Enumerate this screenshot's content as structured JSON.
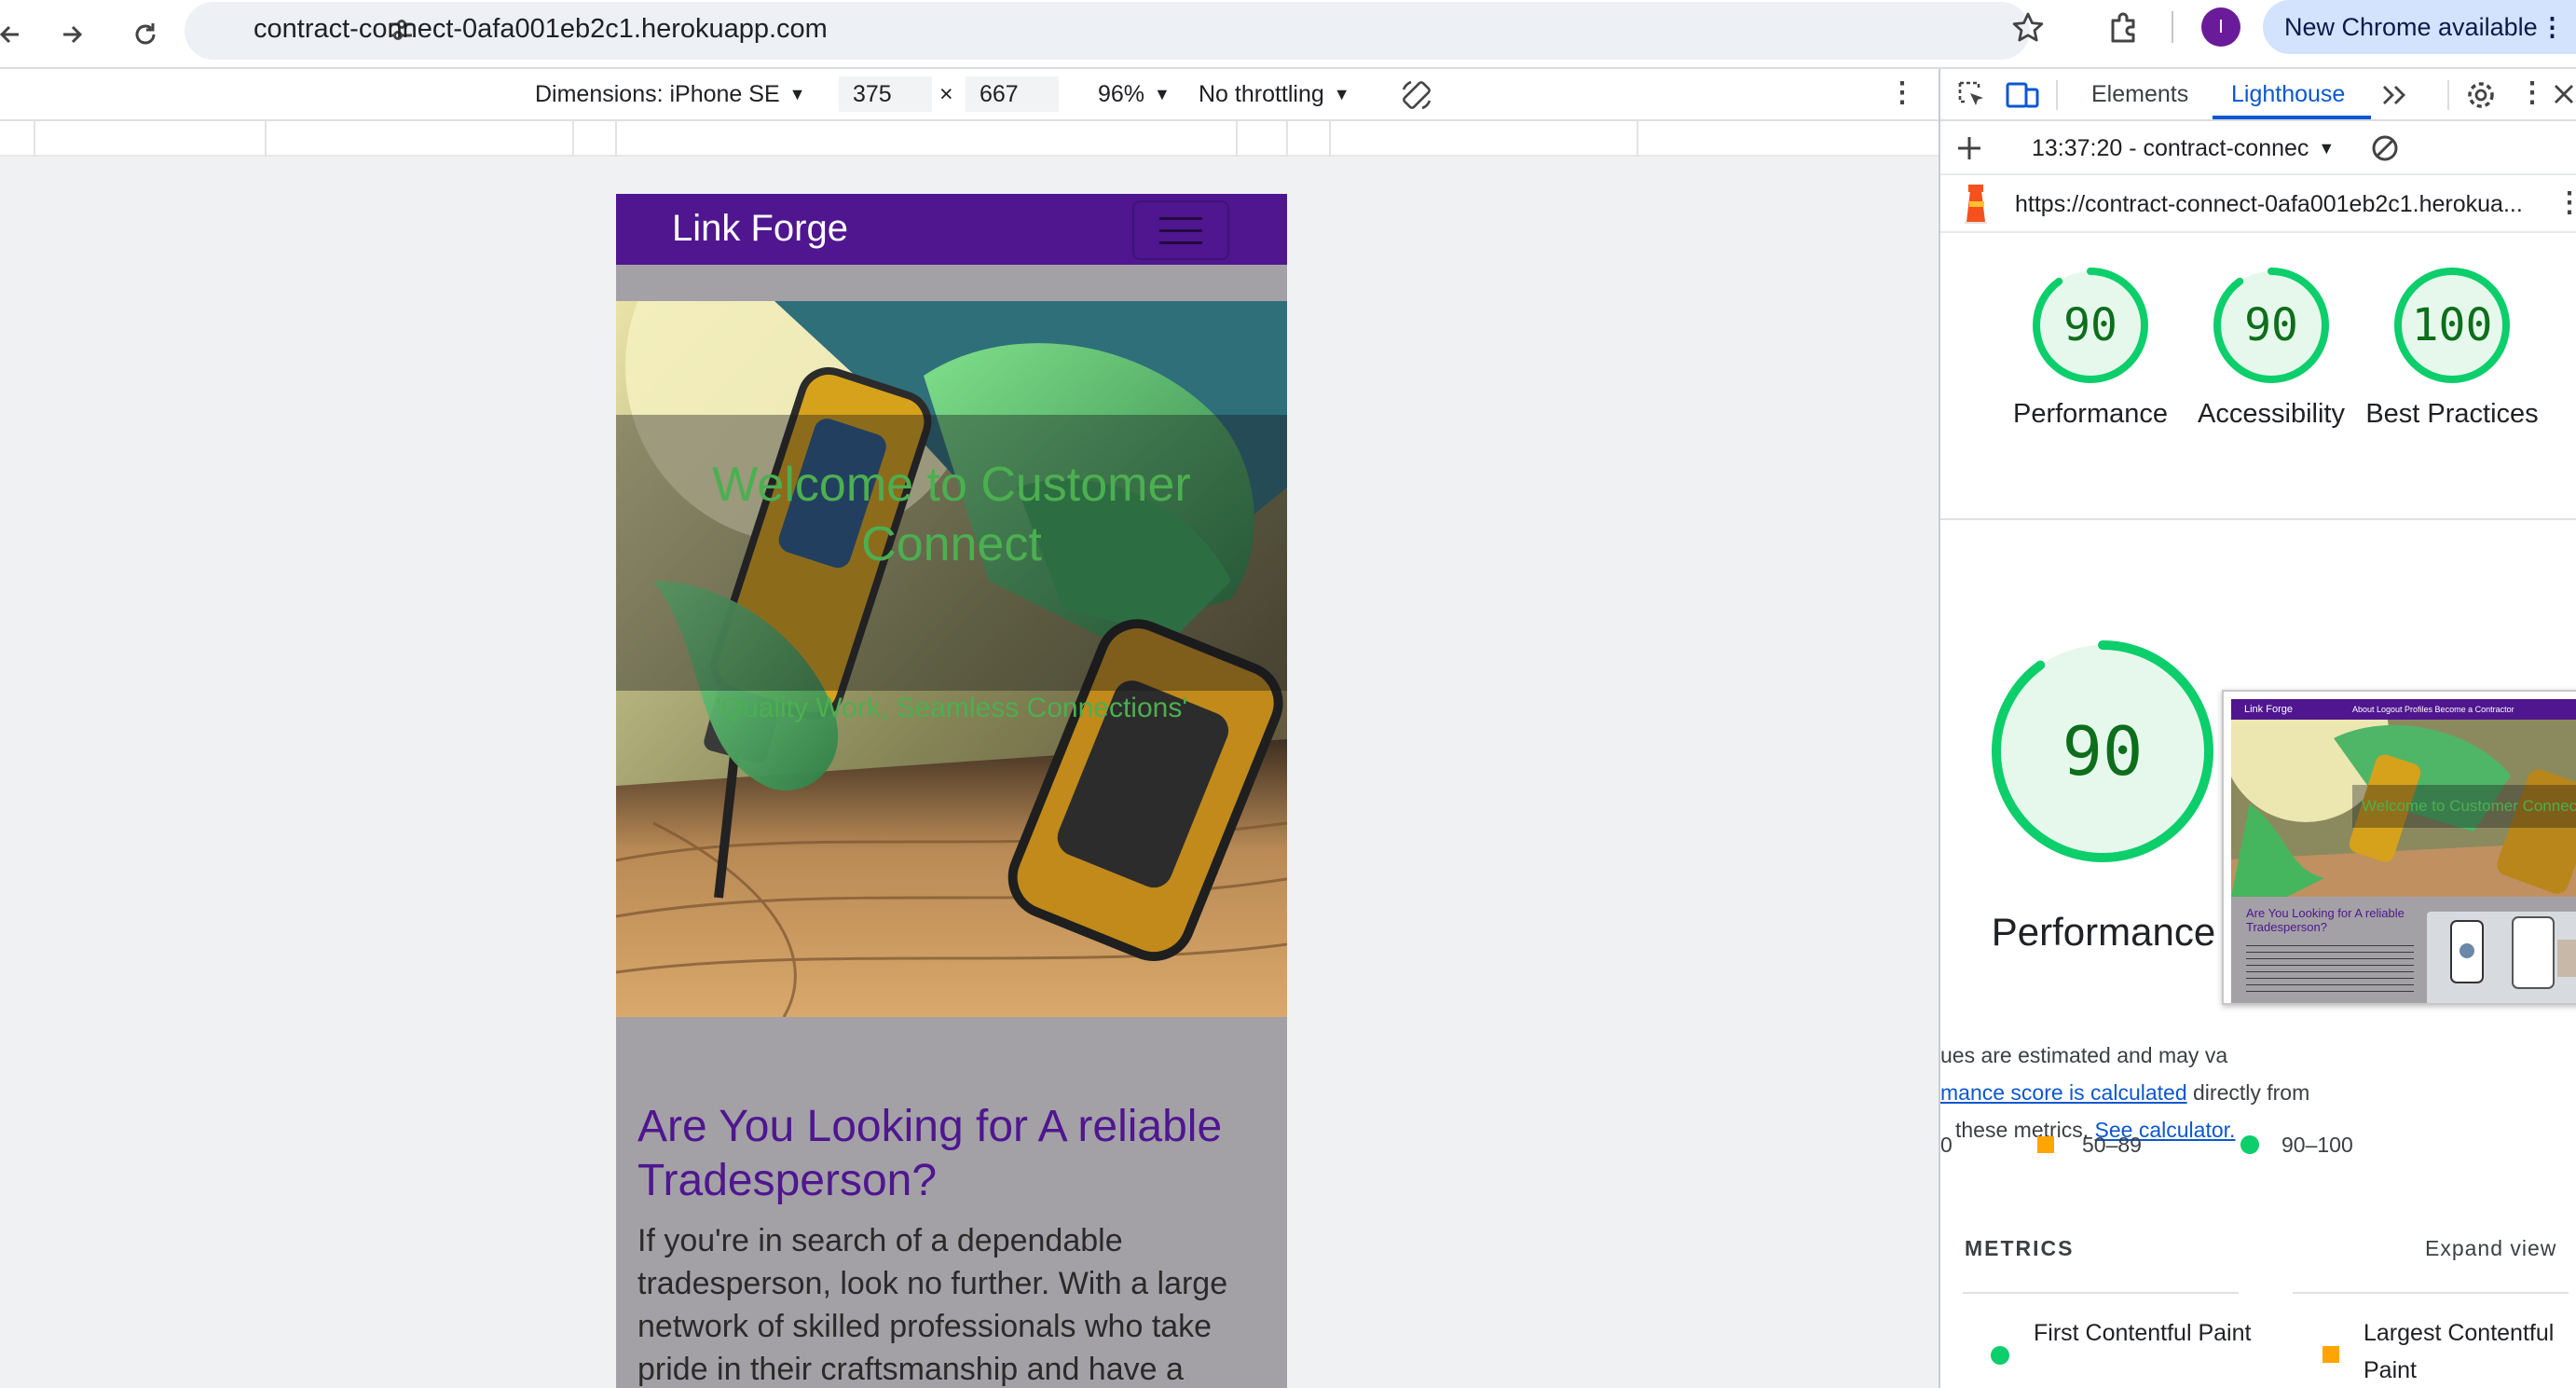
{
  "browser": {
    "url": "contract-connect-0afa001eb2c1.herokuapp.com",
    "avatar_letter": "I",
    "update_label": "New Chrome available",
    "update_dots": "⋮"
  },
  "device_toolbar": {
    "dimensions_label": "Dimensions: iPhone SE",
    "width": "375",
    "times": "×",
    "height": "667",
    "zoom": "96%",
    "throttling": "No throttling"
  },
  "site": {
    "brand": "Link Forge",
    "hero_title": "Welcome to Customer Connect",
    "hero_subtitle": "'Quality Work, Seamless Connections'",
    "section_title": "Are You Looking for A reliable Tradesperson?",
    "section_body": "If you're in search of a dependable tradesperson, look no further. With a large network of skilled professionals who take pride in their craftsmanship and have a"
  },
  "devtools": {
    "tabs": {
      "elements": "Elements",
      "lighthouse": "Lighthouse"
    },
    "report_time": "13:37:20 - contract-connec",
    "report_url": "https://contract-connect-0afa001eb2c1.herokua...",
    "scores": [
      {
        "label": "Performance",
        "value": 90,
        "color": "#0cce6b"
      },
      {
        "label": "Accessibility",
        "value": 90,
        "color": "#0cce6b"
      },
      {
        "label": "Best Practices",
        "value": 100,
        "color": "#0cce6b"
      }
    ],
    "perf": {
      "value": 90,
      "label": "Performance",
      "note_line1": "ues are estimated and may va",
      "link1": "mance score is calculated",
      "note_line2": " directly from",
      "note_line3": "these metrics.",
      "link2": "See calculator."
    },
    "legend": {
      "mid_range": "50–89",
      "high_range": "90–100",
      "low_fragment": "0"
    },
    "metrics_heading": "METRICS",
    "expand_label": "Expand view",
    "metrics": [
      {
        "label": "First Contentful Paint",
        "status": "pass"
      },
      {
        "label": "Largest Contentful Paint",
        "status": "average"
      }
    ],
    "thumbnail": {
      "nav_brand": "Link Forge",
      "nav_links": "About   Logout   Profiles   Become a Contractor",
      "hero_text": "Welcome to Customer Connect",
      "section_title": "Are You Looking for A reliable Tradesperson?"
    }
  }
}
